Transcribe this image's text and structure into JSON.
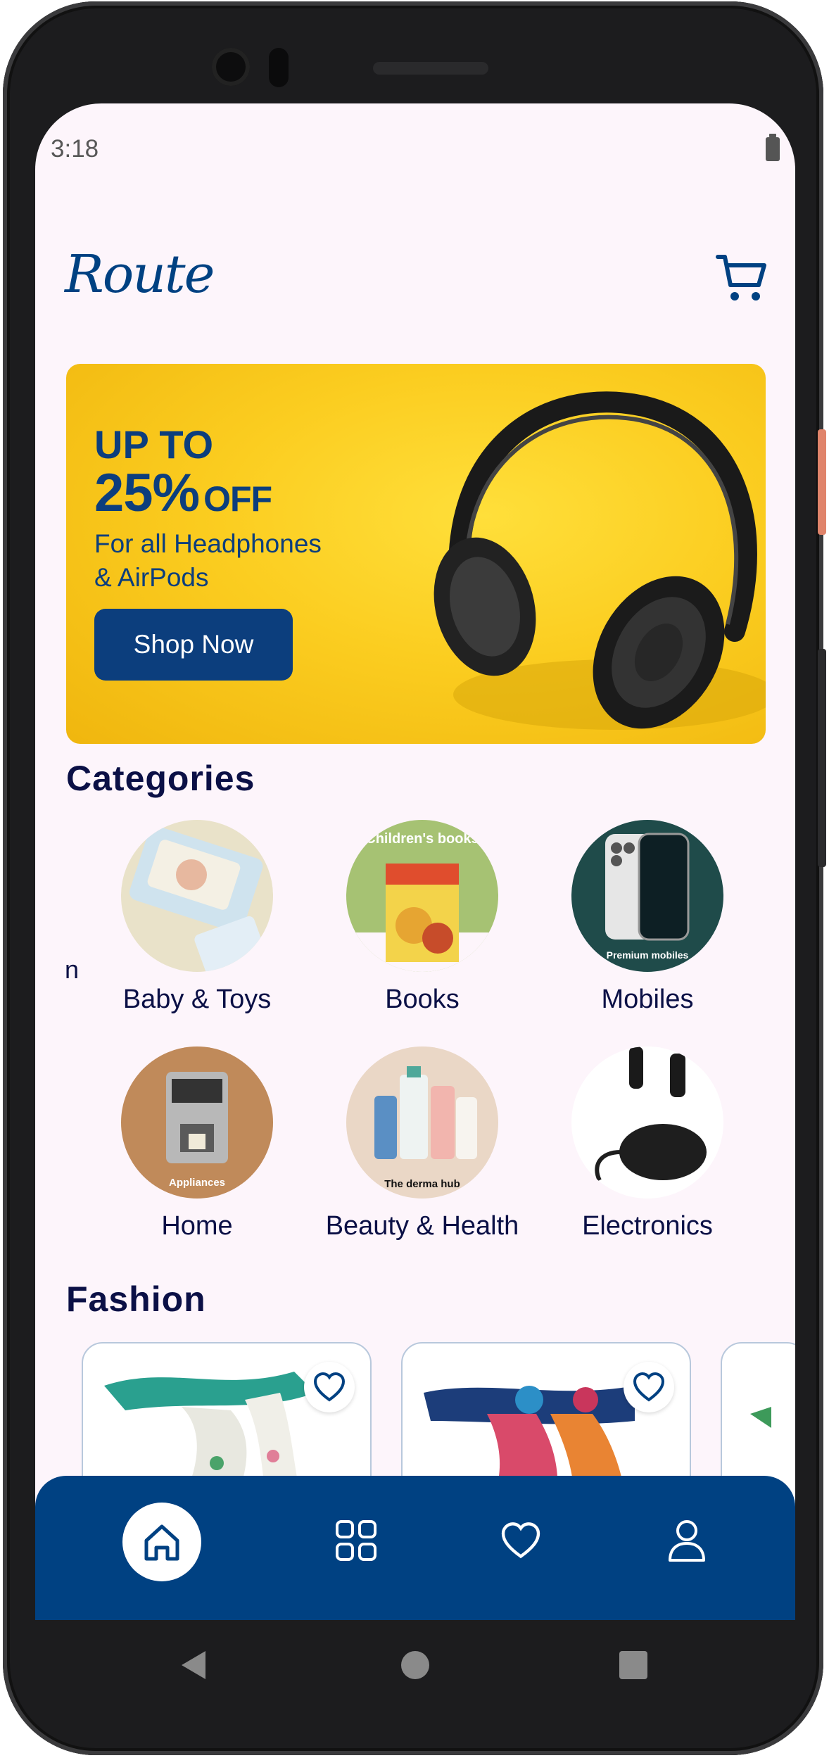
{
  "status_bar": {
    "time": "3:18"
  },
  "header": {
    "logo_text": "Route"
  },
  "banner": {
    "line1": "UP TO",
    "percent": "25%",
    "off": "OFF",
    "line3": "For all Headphones",
    "line4": "& AirPods",
    "button_label": "Shop Now"
  },
  "categories": {
    "title": "Categories",
    "cut_label": "n",
    "items": [
      {
        "label": "Baby & Toys",
        "image_text": ""
      },
      {
        "label": "Books",
        "image_text": "Children's books"
      },
      {
        "label": "Mobiles",
        "image_text": "Premium mobiles"
      },
      {
        "label": "Home",
        "image_text": "Appliances"
      },
      {
        "label": "Beauty & Health",
        "image_text": "The derma hub"
      },
      {
        "label": "Electronics",
        "image_text": ""
      }
    ]
  },
  "fashion": {
    "title": "Fashion"
  },
  "bottom_nav": {
    "items": [
      "home-icon",
      "grid-icon",
      "heart-icon",
      "profile-icon"
    ],
    "active": "home-icon"
  },
  "colors": {
    "primary": "#004182",
    "background": "#fdf5fb",
    "heading": "#0b1046",
    "banner_yellow": "#fbcd20"
  }
}
